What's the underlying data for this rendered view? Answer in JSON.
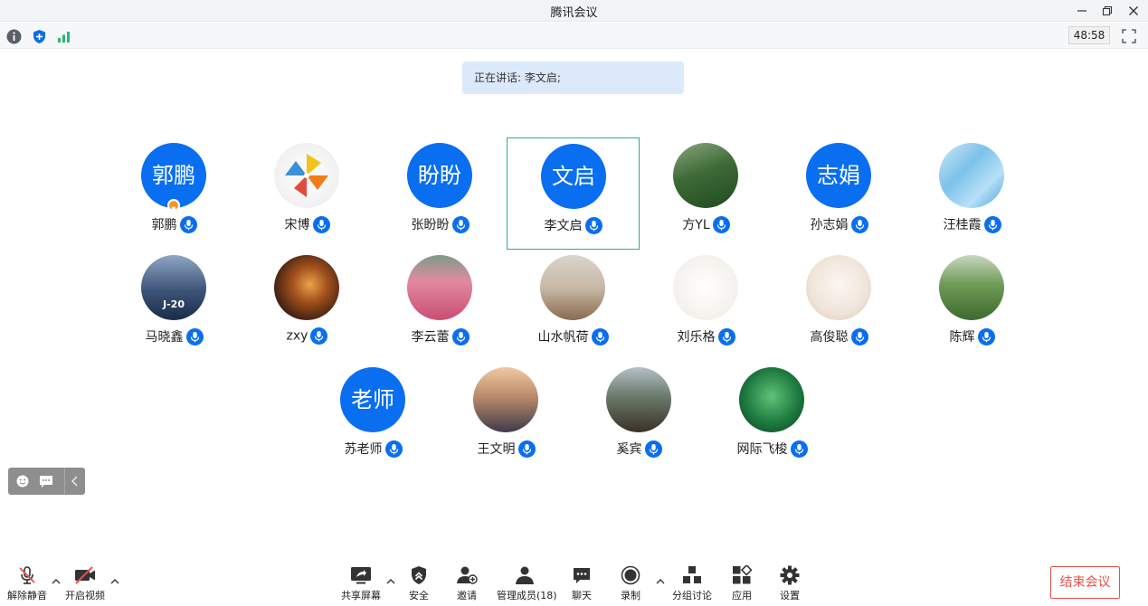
{
  "window": {
    "title": "腾讯会议"
  },
  "infobar": {
    "timer": "48:58",
    "icons": [
      "info-icon",
      "shield-icon",
      "signal-icon",
      "fullscreen-icon"
    ]
  },
  "speaking": {
    "text": "正在讲话: 李文启;"
  },
  "participants": [
    {
      "name": "郭鹏",
      "avatar_text": "郭鹏",
      "avatar_type": "text",
      "host": true
    },
    {
      "name": "宋博",
      "avatar_type": "image",
      "image_desc": "pinwheel"
    },
    {
      "name": "张盼盼",
      "avatar_text": "盼盼",
      "avatar_type": "text"
    },
    {
      "name": "李文启",
      "avatar_text": "文启",
      "avatar_type": "text",
      "active": true
    },
    {
      "name": "方YL",
      "avatar_type": "image",
      "image_desc": "plants"
    },
    {
      "name": "孙志娟",
      "avatar_text": "志娟",
      "avatar_type": "text"
    },
    {
      "name": "汪桂霞",
      "avatar_type": "image",
      "image_desc": "ice"
    },
    {
      "name": "马晓鑫",
      "avatar_type": "image",
      "image_desc": "jet",
      "image_text": "J-20"
    },
    {
      "name": "zxy",
      "avatar_type": "image",
      "image_desc": "sunset-couple"
    },
    {
      "name": "李云蕾",
      "avatar_type": "image",
      "image_desc": "flower-field"
    },
    {
      "name": "山水帆荷",
      "avatar_type": "image",
      "image_desc": "red-flowers"
    },
    {
      "name": "刘乐格",
      "avatar_type": "image",
      "image_desc": "sketch"
    },
    {
      "name": "高俊聪",
      "avatar_type": "image",
      "image_desc": "cat"
    },
    {
      "name": "陈辉",
      "avatar_type": "image",
      "image_desc": "park"
    },
    {
      "name": "苏老师",
      "avatar_text": "老师",
      "avatar_type": "text"
    },
    {
      "name": "王文明",
      "avatar_type": "image",
      "image_desc": "pavilion"
    },
    {
      "name": "奚宾",
      "avatar_type": "image",
      "image_desc": "railway"
    },
    {
      "name": "网际飞梭",
      "avatar_type": "image",
      "image_desc": "green-leaf"
    }
  ],
  "toolbar": {
    "unmute": "解除静音",
    "start_video": "开启视频",
    "share_screen": "共享屏幕",
    "security": "安全",
    "invite": "邀请",
    "manage_members": "管理成员(18)",
    "chat": "聊天",
    "record": "录制",
    "breakout": "分组讨论",
    "apps": "应用",
    "settings": "设置",
    "end_meeting": "结束会议"
  },
  "colors": {
    "accent": "#0a6ef0",
    "active_border": "#2bb673",
    "end_red": "#e8504a",
    "speaking_bg": "#dce9fb"
  }
}
